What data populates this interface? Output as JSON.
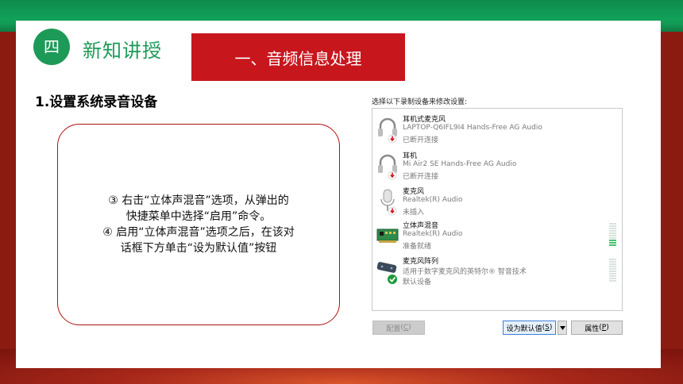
{
  "slide": {
    "section_number": "四",
    "section_title": "新知讲授",
    "banner_title": "一、音频信息处理",
    "step_title": "1.设置系统录音设备",
    "note_lines": [
      "③ 右击“立体声混音”选项，从弹出的",
      "快捷菜单中选择“启用”命令。",
      "④ 启用“立体声混音”选项之后，在该对",
      "话框下方单击“设为默认值”按钮"
    ]
  },
  "dialog": {
    "header": "选择以下录制设备来修改设置:",
    "devices": [
      {
        "name": "耳机式麦克风",
        "detail": "LAPTOP-Q6IFL9I4 Hands-Free AG Audio",
        "status": "已断开连接",
        "icon": "headset-icon",
        "badge": "disconnected-badge-icon"
      },
      {
        "name": "耳机",
        "detail": "Mi Air2 SE Hands-Free AG Audio",
        "status": "已断开连接",
        "icon": "headset-icon",
        "badge": "disconnected-badge-icon"
      },
      {
        "name": "麦克风",
        "detail": "Realtek(R) Audio",
        "status": "未插入",
        "icon": "microphone-icon",
        "badge": "unplugged-badge-icon"
      },
      {
        "name": "立体声混音",
        "detail": "Realtek(R) Audio",
        "status": "准备就绪",
        "icon": "sound-card-icon",
        "badge": "",
        "level": 0.3
      },
      {
        "name": "麦克风阵列",
        "detail": "适用于数字麦克风的英特尔® 智音技术",
        "status": "默认设备",
        "icon": "mic-array-icon",
        "badge": "default-check-icon",
        "level": 0.0
      }
    ],
    "buttons": {
      "configure": "配置",
      "configure_key": "C",
      "set_default": "设为默认值",
      "set_default_key": "S",
      "properties": "属性",
      "properties_key": "P"
    }
  },
  "colors": {
    "green": "#1e9a58",
    "red": "#c8161d",
    "border_red": "#b01010",
    "meter_green": "#49c16b"
  }
}
